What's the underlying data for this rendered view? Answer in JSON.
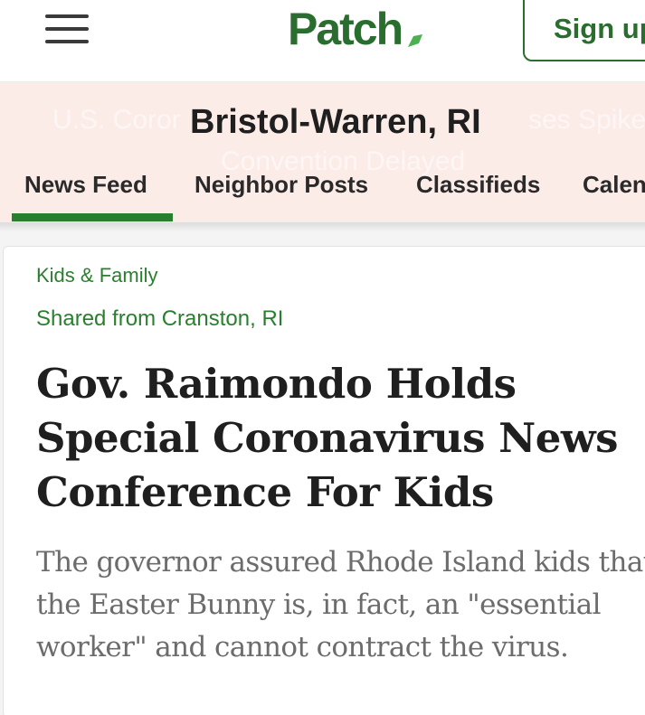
{
  "header": {
    "logo_text": "Patch",
    "signup_label": "Sign up",
    "brand_color": "#2a6e2f",
    "icons": [
      "hamburger-menu-icon",
      "patch-leaf-icon"
    ]
  },
  "community": {
    "title": "Bristol-Warren, RI",
    "background_color": "#fbece8",
    "ticker_left": "U.S. Coror",
    "ticker_right": "ses Spike",
    "ticker_second": "Convention Delayed",
    "tabs": [
      {
        "label": "News Feed",
        "active": true
      },
      {
        "label": "Neighbor Posts",
        "active": false
      },
      {
        "label": "Classifieds",
        "active": false
      },
      {
        "label": "Calendar",
        "active": false
      }
    ]
  },
  "article": {
    "category": "Kids & Family",
    "shared_from": "Shared from Cranston, RI",
    "headline": "Gov. Raimondo Holds Special Coronavirus News Conference For Kids",
    "summary": "The governor assured Rhode Island kids that the Easter Bunny is, in fact, an \"essential worker\" and cannot contract the virus."
  }
}
